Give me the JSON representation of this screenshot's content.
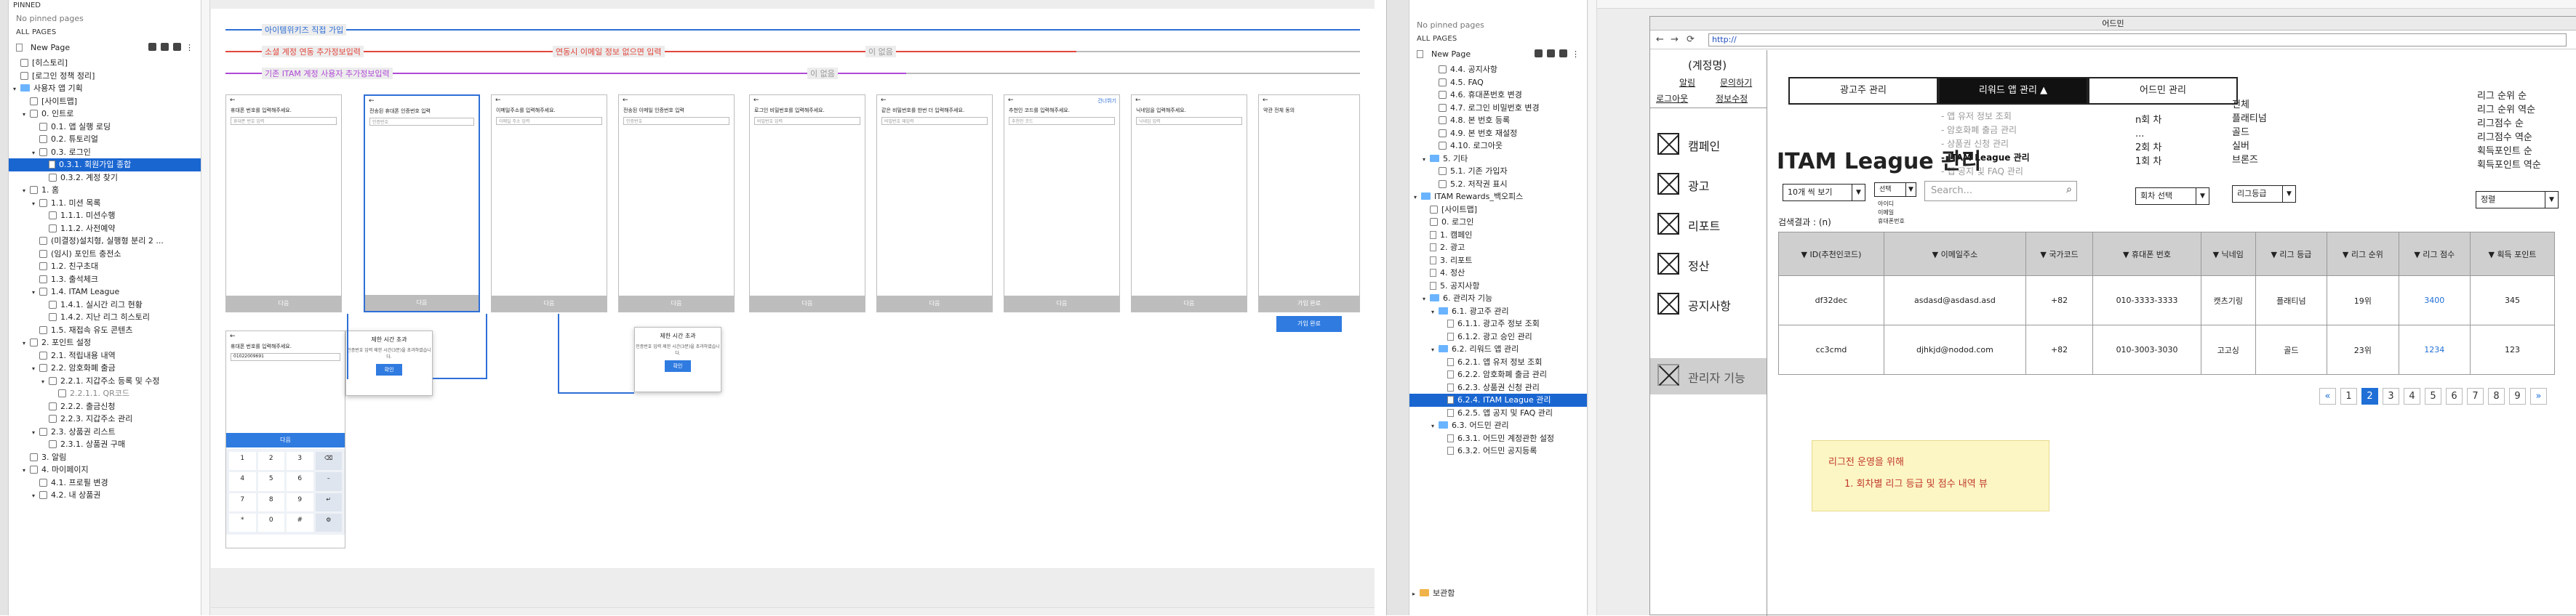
{
  "left_app": {
    "tree": {
      "title": "PINNED",
      "no_pinned": "No pinned pages",
      "all_pages": "ALL PAGES",
      "new_page": "New Page",
      "rows": [
        {
          "label": "[히스토리]",
          "indent": 0,
          "kind": "cb"
        },
        {
          "label": "[로그인 정책 정리]",
          "indent": 0,
          "kind": "cb"
        },
        {
          "label": "사용자 앱 기획",
          "indent": 0,
          "kind": "folder",
          "open": true
        },
        {
          "label": "[사이트맵]",
          "indent": 1,
          "kind": "cb"
        },
        {
          "label": "0. 인트로",
          "indent": 1,
          "kind": "cb",
          "open": true
        },
        {
          "label": "0.1. 앱 실행 로딩",
          "indent": 2,
          "kind": "cb"
        },
        {
          "label": "0.2. 튜토리얼",
          "indent": 2,
          "kind": "cb"
        },
        {
          "label": "0.3. 로그인",
          "indent": 2,
          "kind": "cb",
          "open": true
        },
        {
          "label": "0.3.1. 회원가입 종합",
          "indent": 3,
          "kind": "doc",
          "selected": true
        },
        {
          "label": "0.3.2. 계정 찾기",
          "indent": 3,
          "kind": "cb"
        },
        {
          "label": "1. 홈",
          "indent": 1,
          "kind": "cb",
          "open": true
        },
        {
          "label": "1.1. 미션 목록",
          "indent": 2,
          "kind": "cb",
          "open": true
        },
        {
          "label": "1.1.1. 미션수행",
          "indent": 3,
          "kind": "cb"
        },
        {
          "label": "1.1.2. 사전예약",
          "indent": 3,
          "kind": "cb"
        },
        {
          "label": "(미결정)설치형, 실행형 분리 2 ...",
          "indent": 2,
          "kind": "cb"
        },
        {
          "label": "(임시) 포인트 충전소",
          "indent": 2,
          "kind": "cb"
        },
        {
          "label": "1.2. 친구초대",
          "indent": 2,
          "kind": "cb"
        },
        {
          "label": "1.3. 출석체크",
          "indent": 2,
          "kind": "cb"
        },
        {
          "label": "1.4. ITAM League",
          "indent": 2,
          "kind": "cb",
          "open": true
        },
        {
          "label": "1.4.1. 실시간 리그 현황",
          "indent": 3,
          "kind": "cb"
        },
        {
          "label": "1.4.2. 지난 리그 히스토리",
          "indent": 3,
          "kind": "cb"
        },
        {
          "label": "1.5. 재접속 유도 콘텐츠",
          "indent": 2,
          "kind": "cb"
        },
        {
          "label": "2. 포인트 설정",
          "indent": 1,
          "kind": "cb",
          "open": true
        },
        {
          "label": "2.1. 적립내용 내역",
          "indent": 2,
          "kind": "cb"
        },
        {
          "label": "2.2. 암호화폐 출금",
          "indent": 2,
          "kind": "cb",
          "open": true
        },
        {
          "label": "2.2.1. 지갑주소 등록 및 수정",
          "indent": 3,
          "kind": "cb",
          "open": true
        },
        {
          "label": "2.2.1.1. QR코드",
          "indent": 4,
          "kind": "cb",
          "muted": true
        },
        {
          "label": "2.2.2. 출금신청",
          "indent": 3,
          "kind": "cb"
        },
        {
          "label": "2.2.3. 지갑주소 관리",
          "indent": 3,
          "kind": "cb"
        },
        {
          "label": "2.3. 상품권 리스트",
          "indent": 2,
          "kind": "cb",
          "open": true
        },
        {
          "label": "2.3.1. 상품권 구매",
          "indent": 3,
          "kind": "cb"
        },
        {
          "label": "3. 알림",
          "indent": 1,
          "kind": "cb"
        },
        {
          "label": "4. 마이페이지",
          "indent": 1,
          "kind": "cb",
          "open": true
        },
        {
          "label": "4.1. 프로필 변경",
          "indent": 2,
          "kind": "cb"
        },
        {
          "label": "4.2. 내 상품권",
          "indent": 2,
          "kind": "cb",
          "open": true
        }
      ]
    },
    "flows": [
      {
        "label": "아이템위키즈 직접 가입",
        "color": "#2f6fd6",
        "tail": ""
      },
      {
        "label": "소셜 계정 연동 추가정보입력",
        "color": "#e2463c",
        "tail": "연동시 이메일 정보 없으면 입력",
        "tail2": "이 없음"
      },
      {
        "label": "기존 ITAM 계정 사용자 추가정보입력",
        "color": "#b04ad6",
        "tail": "이 없음"
      }
    ],
    "phones": [
      {
        "title": "휴대폰 번호를 입력해주세요.",
        "placeholder": "휴대폰 번호 입력",
        "foot": "다음"
      },
      {
        "title": "전송된 휴대폰 인증번호 입력",
        "placeholder": "인증번호",
        "foot": "다음"
      },
      {
        "title": "이메일주소를 입력해주세요.",
        "placeholder": "이메일 주소 입력",
        "foot": "다음"
      },
      {
        "title": "전송된 이메일 인증번호 입력",
        "placeholder": "인증번호",
        "foot": "다음"
      },
      {
        "title": "로그인 비밀번호를 입력해주세요.",
        "placeholder": "비밀번호 입력",
        "foot": "다음"
      },
      {
        "title": "같은 비밀번호를 한번 더 입력해주세요.",
        "placeholder": "비밀번호 재입력",
        "foot": "다음"
      },
      {
        "title": "추천인 코드를 입력해주세요.",
        "placeholder": "추천인 코드",
        "foot": "다음"
      },
      {
        "title": "닉네임을 입력해주세요.",
        "placeholder": "닉네임 입력",
        "foot": "다음"
      },
      {
        "title": "약관 전체 동의",
        "placeholder": "",
        "foot": "가입 완료"
      }
    ],
    "keypad_phone": {
      "title": "휴대폰 번호를 입력해주세요.",
      "value": "01022009691",
      "btn": "다음",
      "keys": [
        "1",
        "2",
        "3",
        "4",
        "5",
        "6",
        "7",
        "8",
        "9",
        "*",
        "0",
        "#"
      ]
    },
    "modal1": {
      "title": "제한 시간 초과",
      "body": "인증번호 입력 제한 시간(3분)을 초과하였습니다.",
      "btn": "확인"
    },
    "modal2": {
      "title": "제한 시간 초과",
      "body": "인증번호 입력 제한 시간(3분)을 초과하였습니다.",
      "btn": "확인"
    },
    "skip_label": "건너뛰기"
  },
  "right_app": {
    "tree": {
      "no_pinned": "No pinned pages",
      "all_pages": "ALL PAGES",
      "new_page": "New Page",
      "rows": [
        {
          "label": "4.4. 공지사항",
          "indent": 2,
          "kind": "cb"
        },
        {
          "label": "4.5. FAQ",
          "indent": 2,
          "kind": "cb"
        },
        {
          "label": "4.6. 휴대폰번호 변경",
          "indent": 2,
          "kind": "cb"
        },
        {
          "label": "4.7. 로그인 비밀번호 변경",
          "indent": 2,
          "kind": "cb"
        },
        {
          "label": "4.8. 본 번호 등록",
          "indent": 2,
          "kind": "cb"
        },
        {
          "label": "4.9. 본 번호 재설정",
          "indent": 2,
          "kind": "cb"
        },
        {
          "label": "4.10. 로그아웃",
          "indent": 2,
          "kind": "cb"
        },
        {
          "label": "5. 기타",
          "indent": 1,
          "kind": "folder",
          "open": true
        },
        {
          "label": "5.1. 기존 가입자",
          "indent": 2,
          "kind": "cb"
        },
        {
          "label": "5.2. 저작권 표시",
          "indent": 2,
          "kind": "cb"
        },
        {
          "label": "ITAM Rewards_백오피스",
          "indent": 0,
          "kind": "folder",
          "open": true
        },
        {
          "label": "[사이트맵]",
          "indent": 1,
          "kind": "cb"
        },
        {
          "label": "0. 로그인",
          "indent": 1,
          "kind": "cb"
        },
        {
          "label": "1. 캠페인",
          "indent": 1,
          "kind": "doc"
        },
        {
          "label": "2. 광고",
          "indent": 1,
          "kind": "doc"
        },
        {
          "label": "3. 리포트",
          "indent": 1,
          "kind": "doc"
        },
        {
          "label": "4. 정산",
          "indent": 1,
          "kind": "doc"
        },
        {
          "label": "5. 공지사항",
          "indent": 1,
          "kind": "doc"
        },
        {
          "label": "6. 관리자 기능",
          "indent": 1,
          "kind": "folder",
          "open": true
        },
        {
          "label": "6.1. 광고주 관리",
          "indent": 2,
          "kind": "folder",
          "open": true
        },
        {
          "label": "6.1.1. 광고주 정보 조회",
          "indent": 3,
          "kind": "doc"
        },
        {
          "label": "6.1.2. 광고 승인 관리",
          "indent": 3,
          "kind": "doc"
        },
        {
          "label": "6.2. 리워드 앱 관리",
          "indent": 2,
          "kind": "folder",
          "open": true
        },
        {
          "label": "6.2.1. 앱 유저 정보 조회",
          "indent": 3,
          "kind": "doc"
        },
        {
          "label": "6.2.2. 암호화폐 출금 관리",
          "indent": 3,
          "kind": "doc"
        },
        {
          "label": "6.2.3. 상품권 신청 관리",
          "indent": 3,
          "kind": "doc"
        },
        {
          "label": "6.2.4. ITAM League 관리",
          "indent": 3,
          "kind": "doc",
          "selected": true
        },
        {
          "label": "6.2.5. 앱 공지 및 FAQ 관리",
          "indent": 3,
          "kind": "doc"
        },
        {
          "label": "6.3. 어드민 관리",
          "indent": 2,
          "kind": "folder",
          "open": true
        },
        {
          "label": "6.3.1. 어드민 계정관한 설정",
          "indent": 3,
          "kind": "doc"
        },
        {
          "label": "6.3.2. 어드민 공지등록",
          "indent": 3,
          "kind": "doc"
        }
      ],
      "footer": "보관함"
    },
    "wire": {
      "window_title": "어드민",
      "url": "http://",
      "account": {
        "title": "(계정명)",
        "links": [
          "알림",
          "문의하기",
          "로그아웃",
          "정보수정"
        ]
      },
      "menu": [
        "캠페인",
        "광고",
        "리포트",
        "정산",
        "공지사항"
      ],
      "admin_menu": "관리자 기능",
      "tabs": [
        "광고주 관리",
        "리워드 앱 관리",
        "어드민 관리"
      ],
      "tab_dropdown": [
        "- 앱 유저 정보 조회",
        "- 암호화폐 출금 관리",
        "- 상품권 신청 관리",
        "- ITAM League 관리",
        "- 앱 공지 및 FAQ 관리"
      ],
      "page_title": "ITAM League 관리",
      "page_size": "10개 씩 보기",
      "search_type": {
        "value": "선택",
        "options": [
          "아이디",
          "이메일",
          "휴대폰번호"
        ]
      },
      "search_placeholder": "Search...",
      "round_select": {
        "value": "회차 선택",
        "options": [
          "n회 차",
          "...",
          "2회 차",
          "1회 차"
        ]
      },
      "grade_select": {
        "value": "리그등급",
        "options": [
          "전체",
          "플래티넘",
          "골드",
          "실버",
          "브론즈"
        ]
      },
      "sort_select": {
        "value": "정렬",
        "options": [
          "리그 순위 순",
          "리그 순위 역순",
          "리그점수 순",
          "리그점수 역순",
          "획득포인트 순",
          "획득포인트 역순"
        ]
      },
      "result_count": "검색결과 : (n)",
      "columns": [
        "ID(추천인코드)",
        "이메일주소",
        "국가코드",
        "휴대폰 번호",
        "닉네임",
        "리그 등급",
        "리그 순위",
        "리그 점수",
        "획득 포인트"
      ],
      "rows": [
        [
          "df32dec",
          "asdasd@asdasd.asd",
          "+82",
          "010-3333-3333",
          "캣츠기링",
          "플래티넘",
          "19위",
          "3400",
          "345"
        ],
        [
          "cc3cmd",
          "djhkjd@nodod.com",
          "+82",
          "010-3003-3030",
          "고고싱",
          "골드",
          "23위",
          "1234",
          "123"
        ]
      ],
      "pages": [
        "«",
        "1",
        "2",
        "3",
        "4",
        "5",
        "6",
        "7",
        "8",
        "9",
        "»"
      ],
      "current_page": "2",
      "note": {
        "title": "리그전 운영을 위해",
        "items": [
          "1. 회차별 리그 등급 및 점수 내역 뷰"
        ]
      }
    }
  }
}
